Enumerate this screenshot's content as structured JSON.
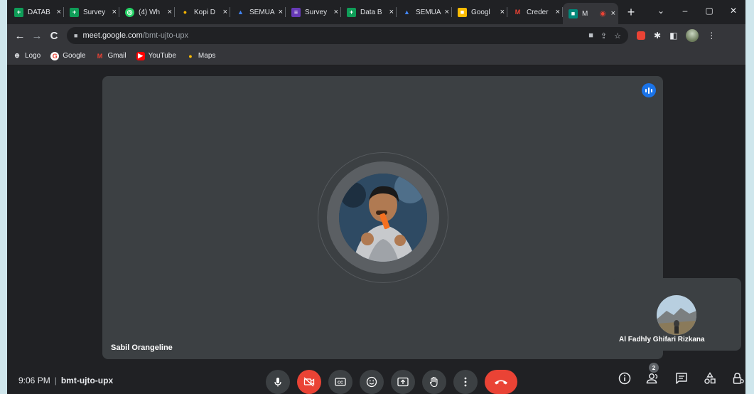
{
  "browser": {
    "tabs": [
      {
        "title": "DATAB",
        "color": "#0f9d58",
        "glyph": "+"
      },
      {
        "title": "Survey",
        "color": "#0f9d58",
        "glyph": "+"
      },
      {
        "title": "(4) Wh",
        "color": "#25d366",
        "glyph": "◎"
      },
      {
        "title": "Kopi D",
        "color": "#f4b400",
        "glyph": "●"
      },
      {
        "title": "SEMUA",
        "color": "#4285f4",
        "glyph": "▲"
      },
      {
        "title": "Survey",
        "color": "#673ab7",
        "glyph": "≡"
      },
      {
        "title": "Data B",
        "color": "#0f9d58",
        "glyph": "+"
      },
      {
        "title": "SEMUA",
        "color": "#4285f4",
        "glyph": "▲"
      },
      {
        "title": "Googl",
        "color": "#fbbc04",
        "glyph": "■"
      },
      {
        "title": "Creder",
        "color": "#ea4335",
        "glyph": "M"
      },
      {
        "title": "M",
        "color": "#00897b",
        "glyph": "■"
      }
    ],
    "tab_close": "×",
    "new_tab": "+",
    "window_controls": [
      "⌄",
      "–",
      "▢",
      "✕"
    ],
    "nav": {
      "back": "←",
      "forward": "→",
      "reload": "C"
    },
    "url_host": "meet.google.com",
    "url_path": "/bmt-ujto-upx",
    "bookmarks": [
      {
        "label": "Logo",
        "color": "#e8eaed",
        "glyph": "⊕"
      },
      {
        "label": "Google",
        "color": "#ea4335",
        "glyph": "G"
      },
      {
        "label": "Gmail",
        "color": "#ea4335",
        "glyph": "M"
      },
      {
        "label": "YouTube",
        "color": "#ff0000",
        "glyph": "▶"
      },
      {
        "label": "Maps",
        "color": "#fbbc04",
        "glyph": "●"
      }
    ]
  },
  "meet": {
    "main_participant": "Sabil Orangeline",
    "tile_participant": "Al Fadhly Ghifari Rizkana",
    "time": "9:06 PM",
    "meeting_code": "bmt-ujto-upx",
    "participant_count": "2"
  },
  "colors": {
    "accent": "#1a73e8",
    "danger": "#ea4335",
    "surface": "#3c4043",
    "background": "#202124"
  }
}
